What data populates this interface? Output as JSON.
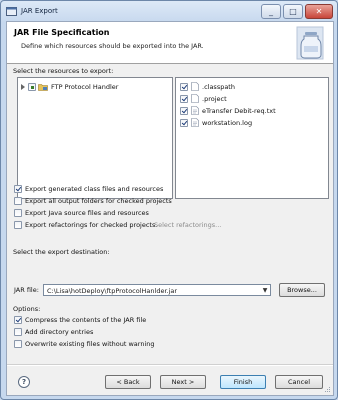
{
  "window": {
    "title": "JAR Export"
  },
  "header": {
    "title": "JAR File Specification",
    "description": "Define which resources should be exported into the JAR."
  },
  "resources": {
    "label": "Select the resources to export:",
    "tree": [
      {
        "label": "FTP Protocol Handler",
        "state": "partial"
      }
    ],
    "files": [
      {
        "label": ".classpath",
        "checked": true
      },
      {
        "label": ".project",
        "checked": true
      },
      {
        "label": "eTransfer Debit-req.txt",
        "checked": true
      },
      {
        "label": "workstation.log",
        "checked": true
      }
    ]
  },
  "export_options": [
    {
      "label": "Export generated class files and resources",
      "checked": true
    },
    {
      "label": "Export all output folders for checked projects",
      "checked": false
    },
    {
      "label": "Export Java source files and resources",
      "checked": false
    },
    {
      "label": "Export refactorings for checked projects.",
      "checked": false,
      "link": "Select refactorings..."
    }
  ],
  "destination": {
    "label": "Select the export destination:",
    "jar_label": "JAR file:",
    "jar_value": "C:\\Lisa\\hotDeploy\\ftpProtocolHanlder.jar",
    "browse_label": "Browse..."
  },
  "options": {
    "label": "Options:",
    "items": [
      {
        "label": "Compress the contents of the JAR file",
        "checked": true
      },
      {
        "label": "Add directory entries",
        "checked": false
      },
      {
        "label": "Overwrite existing files without warning",
        "checked": false
      }
    ]
  },
  "buttons": {
    "back": "< Back",
    "next": "Next >",
    "finish": "Finish",
    "cancel": "Cancel",
    "help": "?"
  }
}
